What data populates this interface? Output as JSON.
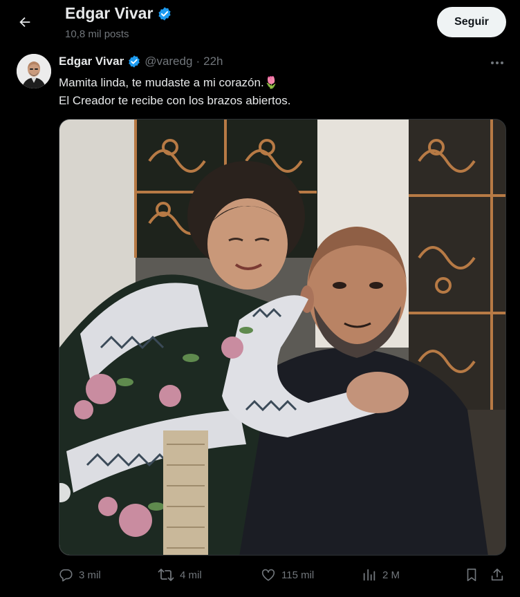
{
  "header": {
    "title": "Edgar Vivar",
    "posts_count": "10,8 mil posts",
    "follow_label": "Seguir"
  },
  "tweet": {
    "author_name": "Edgar Vivar",
    "handle": "@varedg",
    "separator": "·",
    "time": "22h",
    "text_line_1": "Mamita linda, te mudaste a mi corazón.",
    "emoji": "🌷",
    "text_line_2": "El Creador te recibe con los brazos abiertos."
  },
  "actions": {
    "replies": "3 mil",
    "reposts": "4 mil",
    "likes": "115 mil",
    "views": "2 M"
  },
  "colors": {
    "background": "#000000",
    "text_primary": "#e7e9ea",
    "text_secondary": "#71767b",
    "verified": "#1d9bf0",
    "follow_button_bg": "#eff3f4"
  },
  "icons": [
    "back-arrow-icon",
    "verified-badge-icon",
    "more-icon",
    "reply-icon",
    "repost-icon",
    "like-icon",
    "views-icon",
    "bookmark-icon",
    "share-icon"
  ]
}
